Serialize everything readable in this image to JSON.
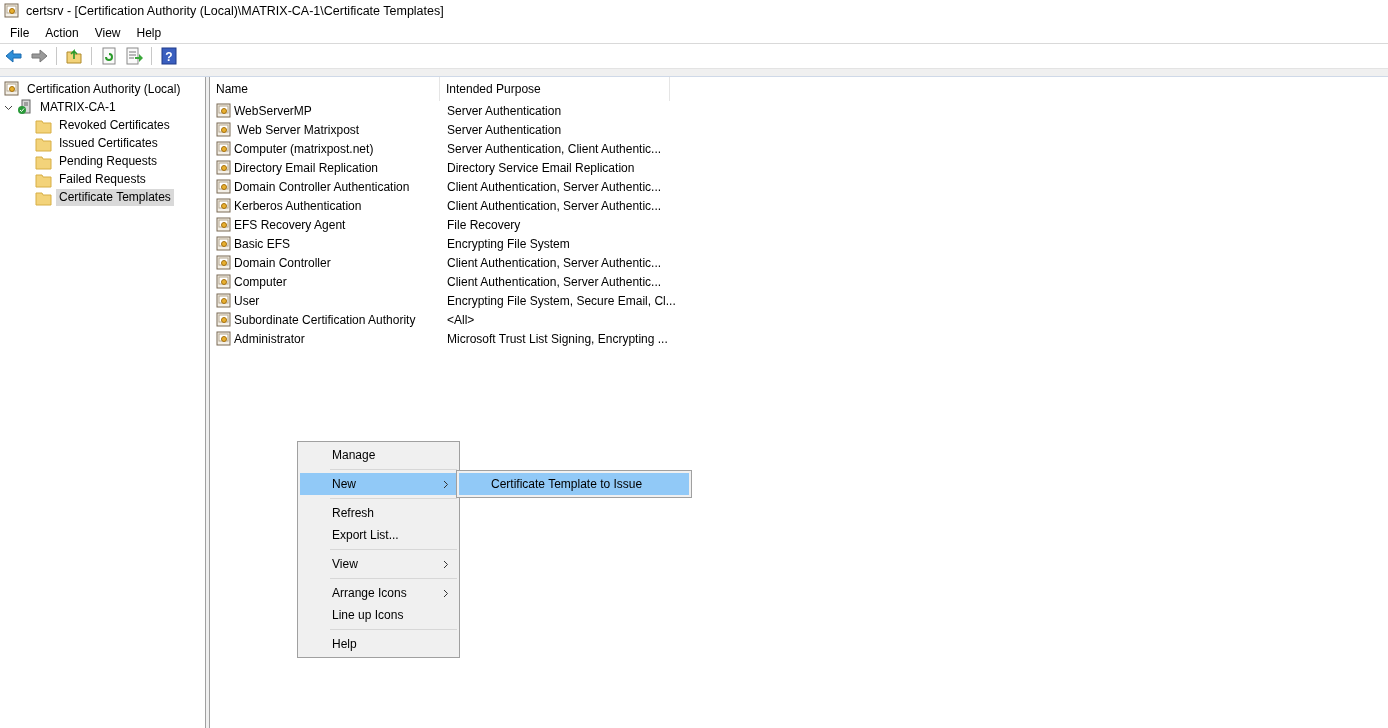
{
  "window": {
    "title": "certsrv - [Certification Authority (Local)\\MATRIX-CA-1\\Certificate Templates]"
  },
  "menu_bar": [
    {
      "label": "File"
    },
    {
      "label": "Action"
    },
    {
      "label": "View"
    },
    {
      "label": "Help"
    }
  ],
  "toolbar": [
    {
      "kind": "back",
      "disabled": false
    },
    {
      "kind": "forward",
      "disabled": true
    },
    {
      "kind": "separator"
    },
    {
      "kind": "up",
      "disabled": false
    },
    {
      "kind": "separator"
    },
    {
      "kind": "refresh",
      "disabled": false
    },
    {
      "kind": "export",
      "disabled": false
    },
    {
      "kind": "separator"
    },
    {
      "kind": "help",
      "label": "?",
      "disabled": false
    }
  ],
  "tree": {
    "label": "Certification Authority (Local)",
    "children": [
      {
        "label": "MATRIX-CA-1",
        "expanded": true,
        "children": [
          {
            "label": "Revoked Certificates",
            "selected": false
          },
          {
            "label": "Issued Certificates",
            "selected": false
          },
          {
            "label": "Pending Requests",
            "selected": false
          },
          {
            "label": "Failed Requests",
            "selected": false
          },
          {
            "label": "Certificate Templates",
            "selected": true
          }
        ]
      }
    ]
  },
  "list": {
    "columns": [
      "Name",
      "Intended Purpose"
    ],
    "rows": [
      {
        "name": "WebServerMP",
        "purpose": "Server Authentication"
      },
      {
        "name": " Web Server Matrixpost",
        "purpose": "Server Authentication"
      },
      {
        "name": "Computer (matrixpost.net)",
        "purpose": "Server Authentication, Client Authentic..."
      },
      {
        "name": "Directory Email Replication",
        "purpose": "Directory Service Email Replication"
      },
      {
        "name": "Domain Controller Authentication",
        "purpose": "Client Authentication, Server Authentic..."
      },
      {
        "name": "Kerberos Authentication",
        "purpose": "Client Authentication, Server Authentic..."
      },
      {
        "name": "EFS Recovery Agent",
        "purpose": "File Recovery"
      },
      {
        "name": "Basic EFS",
        "purpose": "Encrypting File System"
      },
      {
        "name": "Domain Controller",
        "purpose": "Client Authentication, Server Authentic..."
      },
      {
        "name": "Computer",
        "purpose": "Client Authentication, Server Authentic..."
      },
      {
        "name": "User",
        "purpose": "Encrypting File System, Secure Email, Cl..."
      },
      {
        "name": "Subordinate Certification Authority",
        "purpose": "<All>"
      },
      {
        "name": "Administrator",
        "purpose": "Microsoft Trust List Signing, Encrypting ..."
      }
    ]
  },
  "context_menu": {
    "items": [
      {
        "kind": "item",
        "label": "Manage",
        "submenu": false,
        "selected": false
      },
      {
        "kind": "separator"
      },
      {
        "kind": "item",
        "label": "New",
        "submenu": true,
        "selected": true
      },
      {
        "kind": "separator"
      },
      {
        "kind": "item",
        "label": "Refresh",
        "submenu": false,
        "selected": false
      },
      {
        "kind": "item",
        "label": "Export List...",
        "submenu": false,
        "selected": false
      },
      {
        "kind": "separator"
      },
      {
        "kind": "item",
        "label": "View",
        "submenu": true,
        "selected": false
      },
      {
        "kind": "separator"
      },
      {
        "kind": "item",
        "label": "Arrange Icons",
        "submenu": true,
        "selected": false
      },
      {
        "kind": "item",
        "label": "Line up Icons",
        "submenu": false,
        "selected": false
      },
      {
        "kind": "separator"
      },
      {
        "kind": "item",
        "label": "Help",
        "submenu": false,
        "selected": false
      }
    ],
    "submenu": {
      "items": [
        {
          "label": "Certificate Template to Issue",
          "selected": true
        }
      ]
    }
  }
}
